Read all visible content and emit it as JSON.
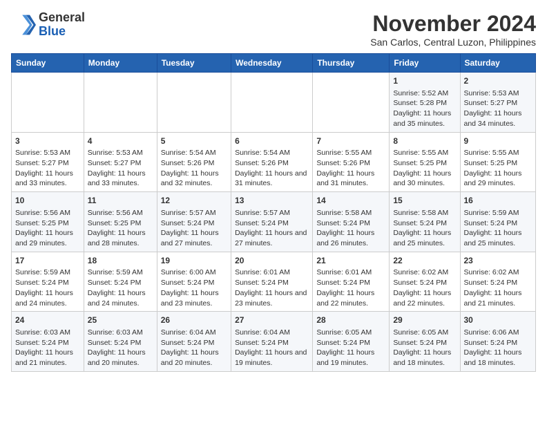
{
  "logo": {
    "general": "General",
    "blue": "Blue"
  },
  "header": {
    "month": "November 2024",
    "location": "San Carlos, Central Luzon, Philippines"
  },
  "weekdays": [
    "Sunday",
    "Monday",
    "Tuesday",
    "Wednesday",
    "Thursday",
    "Friday",
    "Saturday"
  ],
  "weeks": [
    [
      {
        "day": "",
        "info": ""
      },
      {
        "day": "",
        "info": ""
      },
      {
        "day": "",
        "info": ""
      },
      {
        "day": "",
        "info": ""
      },
      {
        "day": "",
        "info": ""
      },
      {
        "day": "1",
        "info": "Sunrise: 5:52 AM\nSunset: 5:28 PM\nDaylight: 11 hours and 35 minutes."
      },
      {
        "day": "2",
        "info": "Sunrise: 5:53 AM\nSunset: 5:27 PM\nDaylight: 11 hours and 34 minutes."
      }
    ],
    [
      {
        "day": "3",
        "info": "Sunrise: 5:53 AM\nSunset: 5:27 PM\nDaylight: 11 hours and 33 minutes."
      },
      {
        "day": "4",
        "info": "Sunrise: 5:53 AM\nSunset: 5:27 PM\nDaylight: 11 hours and 33 minutes."
      },
      {
        "day": "5",
        "info": "Sunrise: 5:54 AM\nSunset: 5:26 PM\nDaylight: 11 hours and 32 minutes."
      },
      {
        "day": "6",
        "info": "Sunrise: 5:54 AM\nSunset: 5:26 PM\nDaylight: 11 hours and 31 minutes."
      },
      {
        "day": "7",
        "info": "Sunrise: 5:55 AM\nSunset: 5:26 PM\nDaylight: 11 hours and 31 minutes."
      },
      {
        "day": "8",
        "info": "Sunrise: 5:55 AM\nSunset: 5:25 PM\nDaylight: 11 hours and 30 minutes."
      },
      {
        "day": "9",
        "info": "Sunrise: 5:55 AM\nSunset: 5:25 PM\nDaylight: 11 hours and 29 minutes."
      }
    ],
    [
      {
        "day": "10",
        "info": "Sunrise: 5:56 AM\nSunset: 5:25 PM\nDaylight: 11 hours and 29 minutes."
      },
      {
        "day": "11",
        "info": "Sunrise: 5:56 AM\nSunset: 5:25 PM\nDaylight: 11 hours and 28 minutes."
      },
      {
        "day": "12",
        "info": "Sunrise: 5:57 AM\nSunset: 5:24 PM\nDaylight: 11 hours and 27 minutes."
      },
      {
        "day": "13",
        "info": "Sunrise: 5:57 AM\nSunset: 5:24 PM\nDaylight: 11 hours and 27 minutes."
      },
      {
        "day": "14",
        "info": "Sunrise: 5:58 AM\nSunset: 5:24 PM\nDaylight: 11 hours and 26 minutes."
      },
      {
        "day": "15",
        "info": "Sunrise: 5:58 AM\nSunset: 5:24 PM\nDaylight: 11 hours and 25 minutes."
      },
      {
        "day": "16",
        "info": "Sunrise: 5:59 AM\nSunset: 5:24 PM\nDaylight: 11 hours and 25 minutes."
      }
    ],
    [
      {
        "day": "17",
        "info": "Sunrise: 5:59 AM\nSunset: 5:24 PM\nDaylight: 11 hours and 24 minutes."
      },
      {
        "day": "18",
        "info": "Sunrise: 5:59 AM\nSunset: 5:24 PM\nDaylight: 11 hours and 24 minutes."
      },
      {
        "day": "19",
        "info": "Sunrise: 6:00 AM\nSunset: 5:24 PM\nDaylight: 11 hours and 23 minutes."
      },
      {
        "day": "20",
        "info": "Sunrise: 6:01 AM\nSunset: 5:24 PM\nDaylight: 11 hours and 23 minutes."
      },
      {
        "day": "21",
        "info": "Sunrise: 6:01 AM\nSunset: 5:24 PM\nDaylight: 11 hours and 22 minutes."
      },
      {
        "day": "22",
        "info": "Sunrise: 6:02 AM\nSunset: 5:24 PM\nDaylight: 11 hours and 22 minutes."
      },
      {
        "day": "23",
        "info": "Sunrise: 6:02 AM\nSunset: 5:24 PM\nDaylight: 11 hours and 21 minutes."
      }
    ],
    [
      {
        "day": "24",
        "info": "Sunrise: 6:03 AM\nSunset: 5:24 PM\nDaylight: 11 hours and 21 minutes."
      },
      {
        "day": "25",
        "info": "Sunrise: 6:03 AM\nSunset: 5:24 PM\nDaylight: 11 hours and 20 minutes."
      },
      {
        "day": "26",
        "info": "Sunrise: 6:04 AM\nSunset: 5:24 PM\nDaylight: 11 hours and 20 minutes."
      },
      {
        "day": "27",
        "info": "Sunrise: 6:04 AM\nSunset: 5:24 PM\nDaylight: 11 hours and 19 minutes."
      },
      {
        "day": "28",
        "info": "Sunrise: 6:05 AM\nSunset: 5:24 PM\nDaylight: 11 hours and 19 minutes."
      },
      {
        "day": "29",
        "info": "Sunrise: 6:05 AM\nSunset: 5:24 PM\nDaylight: 11 hours and 18 minutes."
      },
      {
        "day": "30",
        "info": "Sunrise: 6:06 AM\nSunset: 5:24 PM\nDaylight: 11 hours and 18 minutes."
      }
    ]
  ]
}
